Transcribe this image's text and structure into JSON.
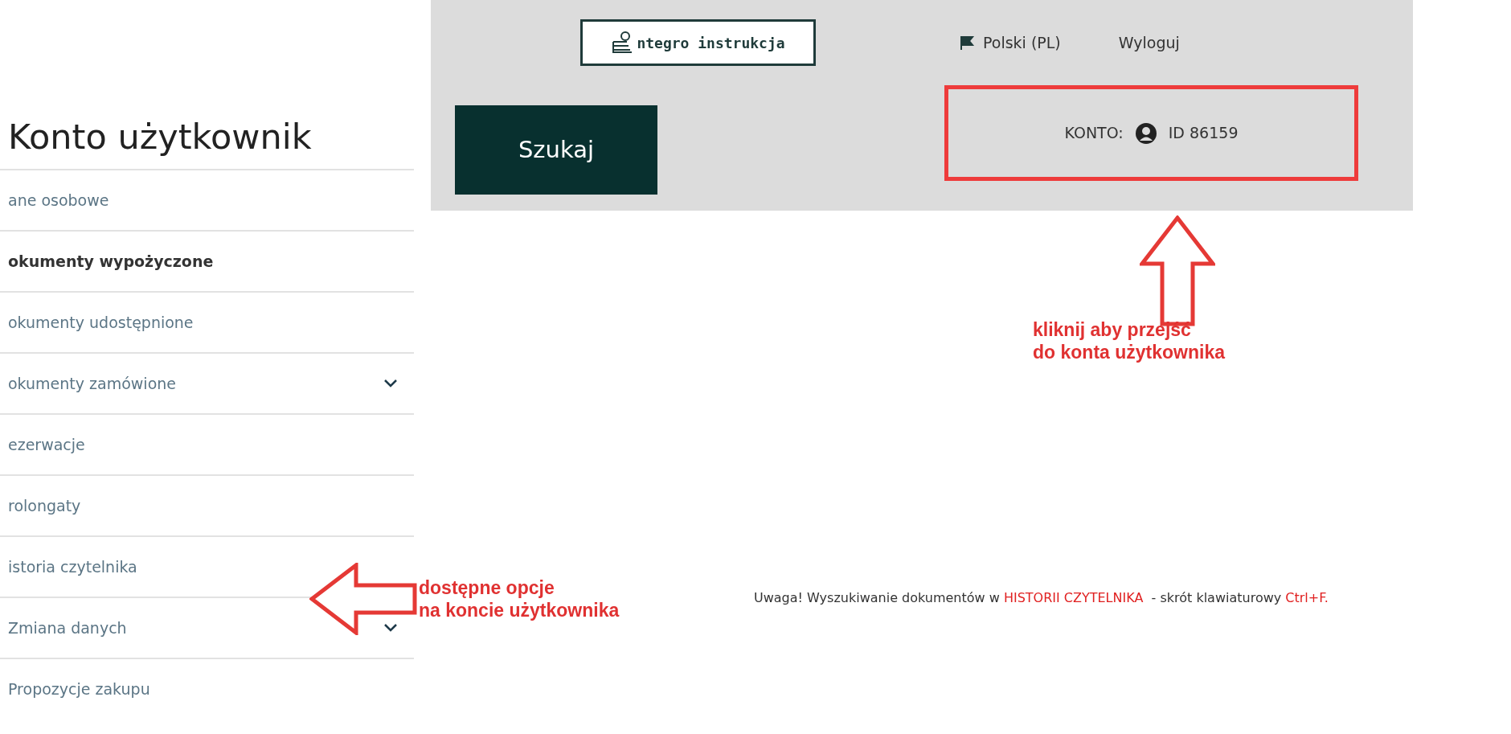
{
  "sidebar": {
    "title": "Konto użytkownik",
    "items": [
      {
        "label": "ane osobowe",
        "selected": false,
        "expandable": false
      },
      {
        "label": "okumenty wypożyczone",
        "selected": true,
        "expandable": false
      },
      {
        "label": "okumenty udostępnione",
        "selected": false,
        "expandable": false
      },
      {
        "label": "okumenty zamówione",
        "selected": false,
        "expandable": true
      },
      {
        "label": "ezerwacje",
        "selected": false,
        "expandable": false
      },
      {
        "label": "rolongaty",
        "selected": false,
        "expandable": false
      },
      {
        "label": "istoria czytelnika",
        "selected": false,
        "expandable": false
      },
      {
        "label": "Zmiana danych",
        "selected": false,
        "expandable": true
      },
      {
        "label": "Propozycje zakupu",
        "selected": false,
        "expandable": false
      }
    ]
  },
  "header": {
    "logo": "ntegro instrukcja",
    "language": "Polski (PL)",
    "logout": "Wyloguj",
    "search_button": "Szukaj",
    "account": {
      "label": "KONTO:",
      "id": "ID 86159"
    }
  },
  "annotations": [
    {
      "kind": "up",
      "text": "kliknij aby przejść\ndo konta użytkownika"
    },
    {
      "kind": "left",
      "text": "dostępne opcje\nna koncie użytkownika"
    }
  ],
  "notice": {
    "parts": [
      {
        "text": "Uwaga! Wyszukiwanie dokumentów w ",
        "highlight": false
      },
      {
        "text": "HISTORII CZYTELNIKA",
        "highlight": true
      },
      {
        "text": "  - skrót klawiaturowy ",
        "highlight": false
      },
      {
        "text": "Ctrl+F.",
        "highlight": true
      }
    ]
  }
}
